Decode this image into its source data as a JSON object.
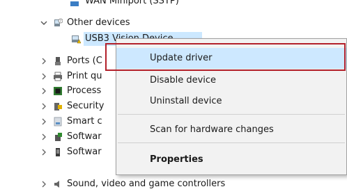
{
  "tree": {
    "top_partial": "WAN Miniport (SSTP)",
    "other_devices": "Other devices",
    "usb3_device": "USB3 Vision Device",
    "rows": [
      {
        "label": "Ports (C"
      },
      {
        "label": "Print qu"
      },
      {
        "label": "Process"
      },
      {
        "label": "Security"
      },
      {
        "label": "Smart c"
      },
      {
        "label": "Softwar"
      },
      {
        "label": "Softwar"
      },
      {
        "label": "Sound, video and game controllers"
      }
    ]
  },
  "context_menu": {
    "update_driver": "Update driver",
    "disable_device": "Disable device",
    "uninstall_device": "Uninstall device",
    "scan_hardware": "Scan for hardware changes",
    "properties": "Properties"
  }
}
